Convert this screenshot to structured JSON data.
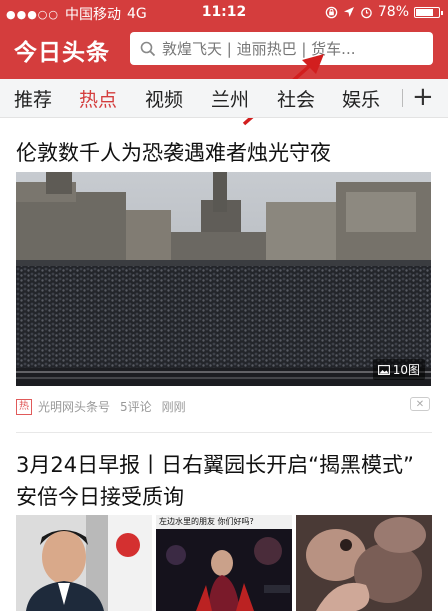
{
  "status_bar": {
    "carrier": "中国移动",
    "network": "4G",
    "time": "11:12",
    "battery": "78%",
    "battery_level": 0.78
  },
  "header": {
    "logo": "今日头条",
    "search_placeholder": "敦煌飞天 | 迪丽热巴 | 货车..."
  },
  "tabs": [
    {
      "label": "推荐"
    },
    {
      "label": "热点",
      "active": true
    },
    {
      "label": "视频"
    },
    {
      "label": "兰州"
    },
    {
      "label": "社会"
    },
    {
      "label": "娱乐"
    }
  ],
  "tab_add": "+",
  "articles": [
    {
      "title": "伦敦数千人为恐袭遇难者烛光守夜",
      "image_count": "10图",
      "hot_badge": "热",
      "source": "光明网头条号",
      "comments": "5评论",
      "time": "刚刚",
      "dismiss": "✕"
    },
    {
      "title": "3月24日早报丨日右翼园长开启“揭黑模式” 安倍今日接受质询",
      "thumb_caption": "左边水里的朋友 你们好吗?"
    }
  ],
  "colors": {
    "brand_red": "#d43d3d",
    "tab_bg": "#f4f5f6"
  }
}
